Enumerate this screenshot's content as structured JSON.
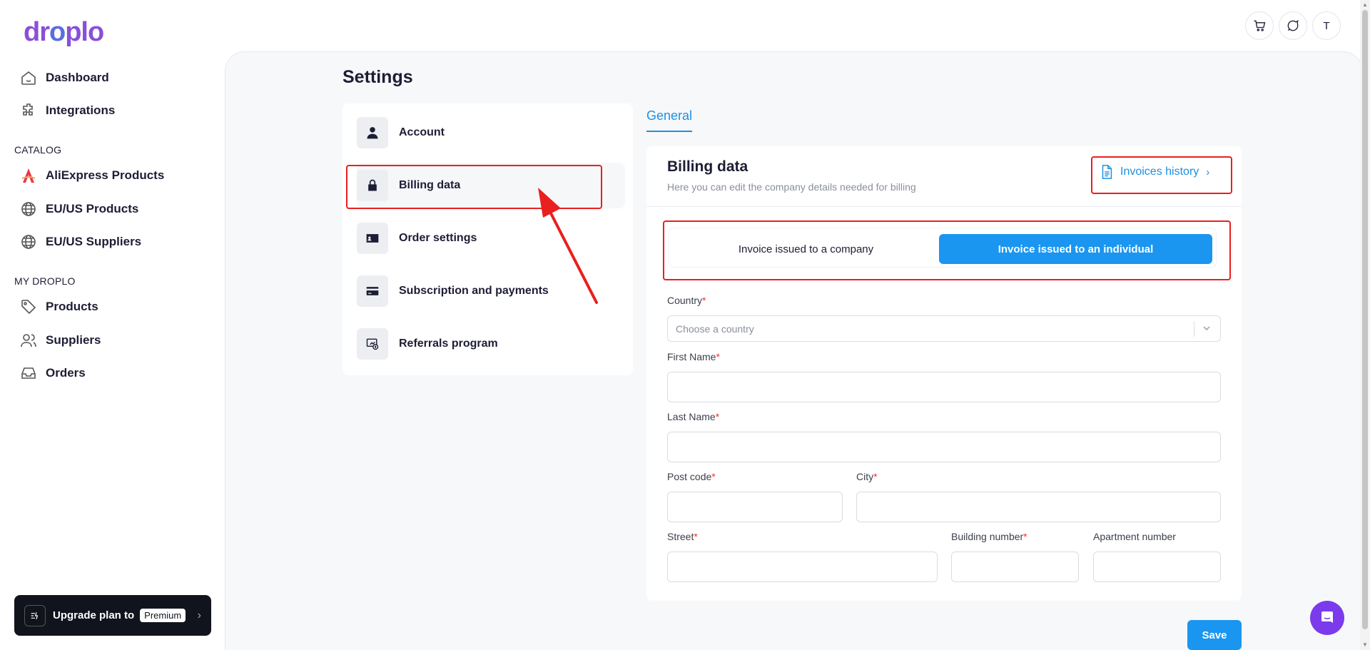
{
  "brand": {
    "logo_text_a": "dr",
    "logo_text_o": "o",
    "logo_text_b": "plo"
  },
  "sidebar": {
    "items": [
      {
        "label": "Dashboard",
        "icon": "home-icon"
      },
      {
        "label": "Integrations",
        "icon": "puzzle-icon"
      }
    ],
    "catalog_title": "CATALOG",
    "catalog": [
      {
        "label": "AliExpress Products",
        "icon": "aliexpress-icon"
      },
      {
        "label": "EU/US Products",
        "icon": "globe-icon"
      },
      {
        "label": "EU/US Suppliers",
        "icon": "globe-icon"
      }
    ],
    "my_title": "MY DROPLO",
    "my": [
      {
        "label": "Products",
        "icon": "tag-icon"
      },
      {
        "label": "Suppliers",
        "icon": "users-icon"
      },
      {
        "label": "Orders",
        "icon": "inbox-icon"
      }
    ],
    "upgrade": {
      "label": "Upgrade plan to",
      "badge": "Premium"
    }
  },
  "topbar": {
    "avatar_letter": "T"
  },
  "settings": {
    "title": "Settings",
    "menu": [
      {
        "label": "Account",
        "icon": "user-icon"
      },
      {
        "label": "Billing data",
        "icon": "lock-icon",
        "active": true
      },
      {
        "label": "Order settings",
        "icon": "id-card-icon"
      },
      {
        "label": "Subscription and payments",
        "icon": "credit-card-icon"
      },
      {
        "label": "Referrals program",
        "icon": "referral-icon"
      }
    ],
    "tab": "General"
  },
  "billing": {
    "title": "Billing data",
    "subtitle": "Here you can edit the company details needed for billing",
    "invoices_history": "Invoices history",
    "toggle": {
      "company": "Invoice issued to a company",
      "individual": "Invoice issued to an individual",
      "selected": "individual"
    },
    "fields": {
      "country": {
        "label": "Country",
        "placeholder": "Choose a country"
      },
      "first_name": {
        "label": "First Name",
        "value": ""
      },
      "last_name": {
        "label": "Last Name",
        "value": ""
      },
      "post_code": {
        "label": "Post code",
        "value": ""
      },
      "city": {
        "label": "City",
        "value": ""
      },
      "street": {
        "label": "Street",
        "value": ""
      },
      "building_number": {
        "label": "Building number",
        "value": ""
      },
      "apartment_number": {
        "label": "Apartment number",
        "value": ""
      }
    },
    "required_mark": "*",
    "save": "Save"
  },
  "colors": {
    "accent": "#1a96f0",
    "annotation": "#e8201e",
    "chat": "#7c3aed"
  }
}
